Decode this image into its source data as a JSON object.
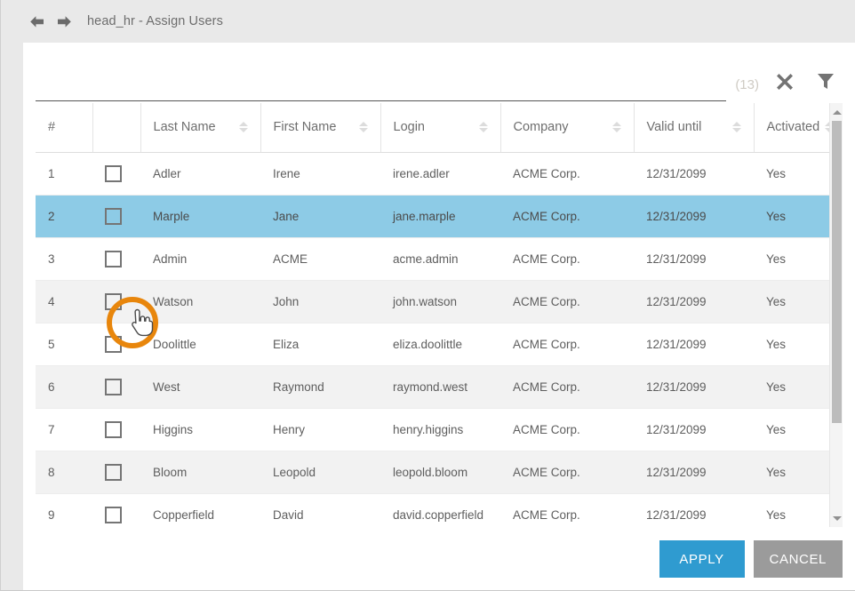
{
  "window": {
    "title": "head_hr - Assign Users",
    "back_icon": "arrow-left-icon",
    "forward_icon": "arrow-right-icon"
  },
  "search": {
    "value": "",
    "placeholder": "",
    "count_label": "(13)",
    "clear_icon": "close-x-icon",
    "filter_icon": "funnel-filter-icon"
  },
  "table": {
    "columns": [
      {
        "key": "num",
        "label": "#",
        "sortable": false
      },
      {
        "key": "check",
        "label": "",
        "sortable": false
      },
      {
        "key": "last",
        "label": "Last Name",
        "sortable": true
      },
      {
        "key": "first",
        "label": "First Name",
        "sortable": true
      },
      {
        "key": "login",
        "label": "Login",
        "sortable": true
      },
      {
        "key": "company",
        "label": "Company",
        "sortable": true
      },
      {
        "key": "valid",
        "label": "Valid until",
        "sortable": true
      },
      {
        "key": "active",
        "label": "Activated",
        "sortable": true
      }
    ],
    "rows": [
      {
        "num": "1",
        "checked": false,
        "last": "Adler",
        "first": "Irene",
        "login": "irene.adler",
        "company": "ACME Corp.",
        "valid": "12/31/2099",
        "active": "Yes",
        "selected": false
      },
      {
        "num": "2",
        "checked": false,
        "last": "Marple",
        "first": "Jane",
        "login": "jane.marple",
        "company": "ACME Corp.",
        "valid": "12/31/2099",
        "active": "Yes",
        "selected": true
      },
      {
        "num": "3",
        "checked": false,
        "last": "Admin",
        "first": "ACME",
        "login": "acme.admin",
        "company": "ACME Corp.",
        "valid": "12/31/2099",
        "active": "Yes",
        "selected": false
      },
      {
        "num": "4",
        "checked": false,
        "last": "Watson",
        "first": "John",
        "login": "john.watson",
        "company": "ACME Corp.",
        "valid": "12/31/2099",
        "active": "Yes",
        "selected": false
      },
      {
        "num": "5",
        "checked": false,
        "last": "Doolittle",
        "first": "Eliza",
        "login": "eliza.doolittle",
        "company": "ACME Corp.",
        "valid": "12/31/2099",
        "active": "Yes",
        "selected": false
      },
      {
        "num": "6",
        "checked": false,
        "last": "West",
        "first": "Raymond",
        "login": "raymond.west",
        "company": "ACME Corp.",
        "valid": "12/31/2099",
        "active": "Yes",
        "selected": false
      },
      {
        "num": "7",
        "checked": false,
        "last": "Higgins",
        "first": "Henry",
        "login": "henry.higgins",
        "company": "ACME Corp.",
        "valid": "12/31/2099",
        "active": "Yes",
        "selected": false
      },
      {
        "num": "8",
        "checked": false,
        "last": "Bloom",
        "first": "Leopold",
        "login": "leopold.bloom",
        "company": "ACME Corp.",
        "valid": "12/31/2099",
        "active": "Yes",
        "selected": false
      },
      {
        "num": "9",
        "checked": false,
        "last": "Copperfield",
        "first": "David",
        "login": "david.copperfield",
        "company": "ACME Corp.",
        "valid": "12/31/2099",
        "active": "Yes",
        "selected": false
      }
    ]
  },
  "scrollbar": {
    "up_icon": "chevron-up-icon",
    "down_icon": "chevron-down-icon"
  },
  "footer": {
    "apply_label": "APPLY",
    "cancel_label": "CANCEL"
  },
  "annotation": {
    "ring_color": "#e8860c",
    "cursor_icon": "hand-pointer-cursor",
    "target": "row-2-checkbox"
  },
  "colors": {
    "selected_row": "#8dcbe6",
    "apply_button": "#2f9bd0",
    "cancel_button": "#9b9b9b",
    "highlight_ring": "#e8860c",
    "zebra_row": "#f2f2f2",
    "window_chrome": "#e9e9e9"
  }
}
